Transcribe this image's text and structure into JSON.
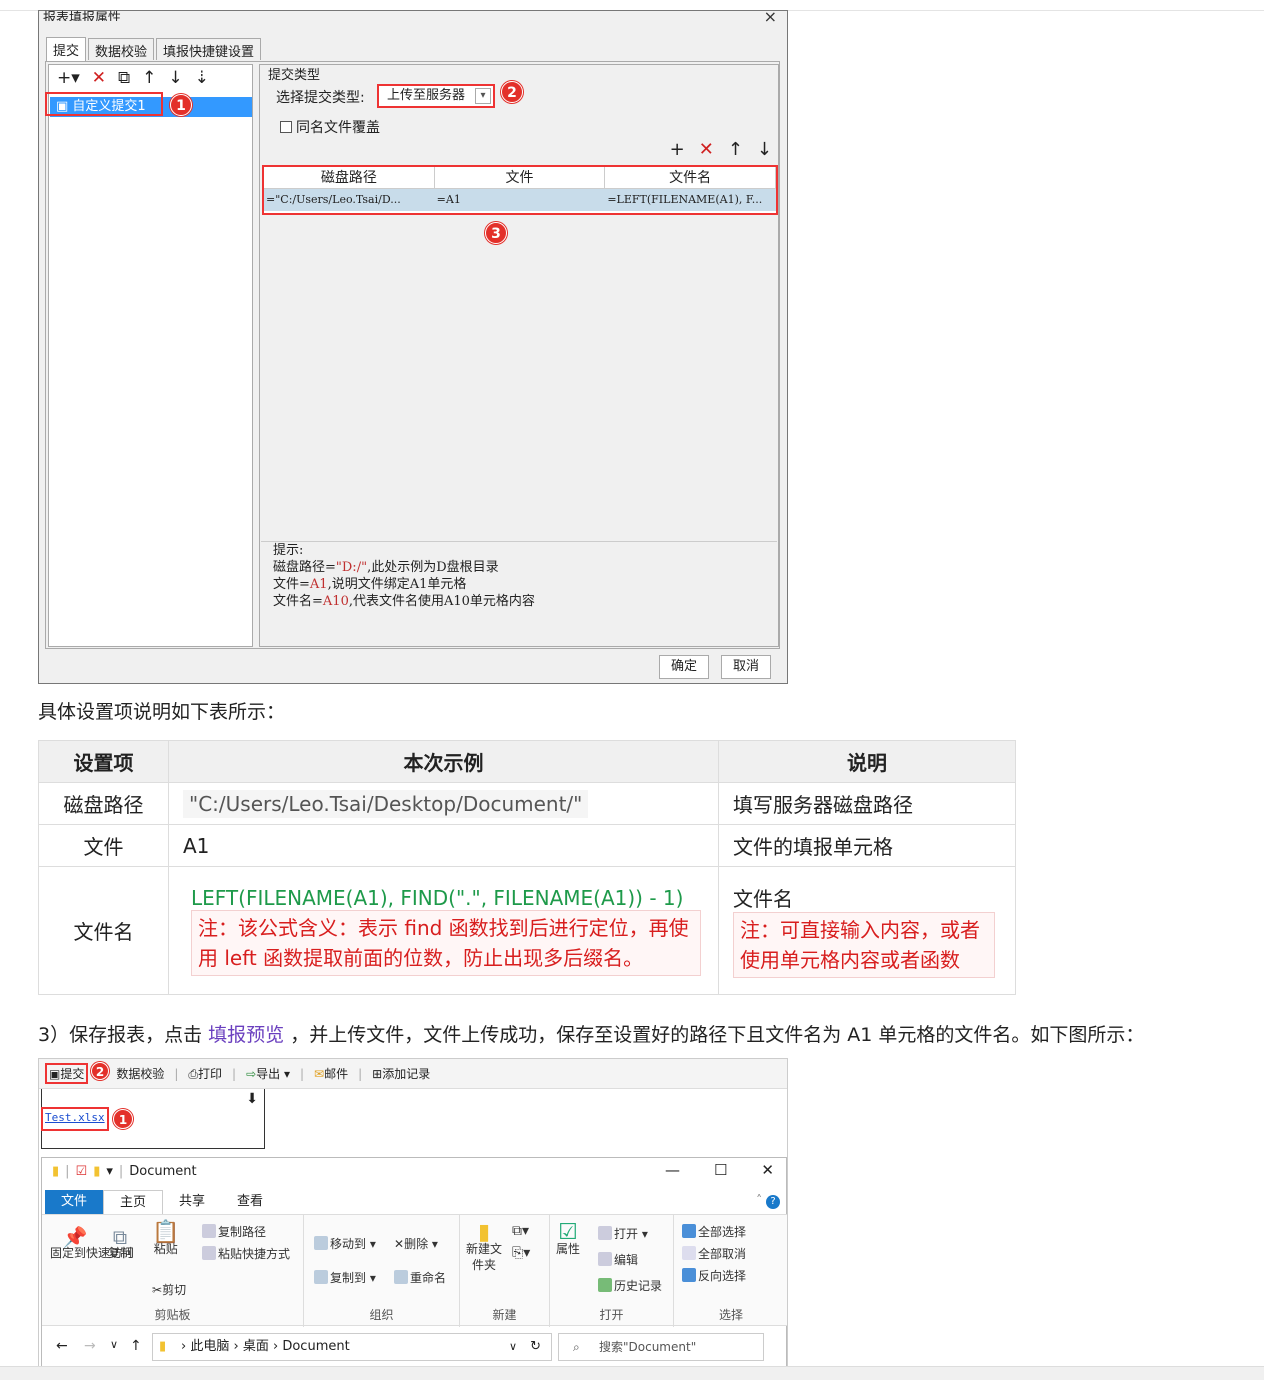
{
  "dialog": {
    "title": "报表填报属性",
    "close": "×",
    "tabs": [
      "提交",
      "数据校验",
      "填报快捷键设置"
    ],
    "left_toolbar": {
      "add": "+▾",
      "delete": "✕",
      "copy": "⧉",
      "up": "↑",
      "down": "↓",
      "sort": "⇣"
    },
    "list_item": "自定义提交1",
    "submit_type_legend": "提交类型",
    "select_type_label": "选择提交类型:",
    "select_type_value": "上传至服务器",
    "overwrite_label": "同名文件覆盖",
    "table_tools": {
      "add": "+",
      "delete": "✕",
      "up": "↑",
      "down": "↓"
    },
    "table_headers": [
      "磁盘路径",
      "文件",
      "文件名"
    ],
    "table_row": [
      "=\"C:/Users/Leo.Tsai/D...",
      "=A1",
      "=LEFT(FILENAME(A1), F..."
    ],
    "hint": {
      "title": "提示:",
      "line1_a": "磁盘路径=",
      "line1_b": "\"D:/\"",
      "line1_c": ",此处示例为D盘根目录",
      "line2_a": "文件=",
      "line2_b": "A1",
      "line2_c": ",说明文件绑定A1单元格",
      "line3_a": "文件名=",
      "line3_b": "A10",
      "line3_c": ",代表文件名使用A10单元格内容"
    },
    "ok": "确定",
    "cancel": "取消",
    "badges": [
      "1",
      "2",
      "3"
    ]
  },
  "description": "具体设置项说明如下表所示：",
  "settings_table": {
    "headers": [
      "设置项",
      "本次示例",
      "说明"
    ],
    "rows": [
      {
        "item": "磁盘路径",
        "example": "\"C:/Users/Leo.Tsai/Desktop/Document/\"",
        "desc": "填写服务器磁盘路径"
      },
      {
        "item": "文件",
        "example": "A1",
        "desc": "文件的填报单元格"
      },
      {
        "item": "文件名",
        "example": "LEFT(FILENAME(A1), FIND(\".\", FILENAME(A1)) - 1)",
        "example_note": "注：该公式含义：表示 find 函数找到后进行定位，再使用 left 函数提取前面的位数，防止出现多后缀名。",
        "desc": "文件名",
        "desc_note": "注：可直接输入内容，或者使用单元格内容或者函数"
      }
    ]
  },
  "paragraph": {
    "before": "3）保存报表，点击",
    "link": "填报预览",
    "after": "，并上传文件，文件上传成功，保存至设置好的路径下且文件名为 A1 单元格的文件名。如下图所示："
  },
  "preview": {
    "toolbar": [
      "提交",
      "数据校验",
      "打印",
      "导出 ▾",
      "邮件",
      "添加记录"
    ],
    "file_link": "Test.xlsx",
    "badges": [
      "2",
      "1"
    ],
    "explorer": {
      "title": "Document",
      "win_controls": [
        "—",
        "☐",
        "✕"
      ],
      "tabs": [
        "文件",
        "主页",
        "共享",
        "查看"
      ],
      "clipboard": {
        "pin": "固定到快速访问",
        "copy": "复制",
        "paste": "粘贴",
        "copy_path": "复制路径",
        "paste_shortcut": "粘贴快捷方式",
        "cut": "剪切",
        "label": "剪贴板"
      },
      "organize": {
        "move_to": "移动到 ▾",
        "delete": "删除 ▾",
        "copy_to": "复制到 ▾",
        "rename": "重命名",
        "label": "组织"
      },
      "new": {
        "new_folder": "新建文件夹",
        "label": "新建"
      },
      "open": {
        "properties": "属性",
        "open": "打开 ▾",
        "edit": "编辑",
        "history": "历史记录",
        "label": "打开"
      },
      "select": {
        "select_all": "全部选择",
        "select_none": "全部取消",
        "invert": "反向选择",
        "label": "选择"
      },
      "path": [
        "此电脑",
        "桌面",
        "Document"
      ],
      "search_placeholder": "搜索\"Document\""
    }
  },
  "colors": {
    "accent_red": "#e3302a",
    "link_purple": "#6a3fbf",
    "formula_green": "#1e9a4a",
    "selection_blue": "#3399ff"
  }
}
